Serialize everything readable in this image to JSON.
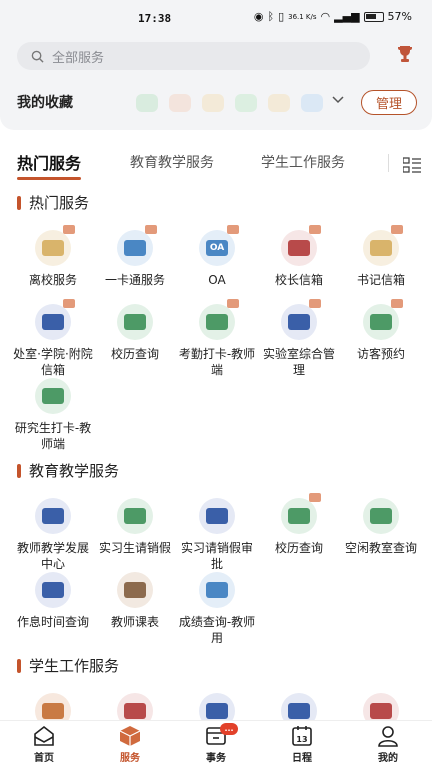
{
  "status": {
    "time": "17:38",
    "network": "36.1 K/s",
    "battery": "57%"
  },
  "search": {
    "placeholder": "全部服务"
  },
  "favorites": {
    "label": "我的收藏",
    "manage_label": "管理"
  },
  "tabs": [
    "热门服务",
    "教育教学服务",
    "学生工作服务"
  ],
  "sections": [
    {
      "title": "热门服务",
      "items": [
        {
          "label": "离校服务",
          "icon": "leave-school-icon",
          "bg": "c-sand",
          "glyph": "g-sand",
          "mark": true
        },
        {
          "label": "一卡通服务",
          "icon": "campus-card-icon",
          "bg": "c-blue",
          "glyph": "g-blue",
          "mark": true
        },
        {
          "label": "OA",
          "icon": "oa-icon",
          "bg": "c-blue",
          "glyph": "g-blue",
          "mark": true,
          "oa": "OA"
        },
        {
          "label": "校长信箱",
          "icon": "president-mailbox-icon",
          "bg": "c-red",
          "glyph": "g-red",
          "mark": true
        },
        {
          "label": "书记信箱",
          "icon": "secretary-mailbox-icon",
          "bg": "c-sand",
          "glyph": "g-sand",
          "mark": true
        },
        {
          "label": "处室·学院·附院信箱",
          "icon": "department-mailbox-icon",
          "bg": "c-navy",
          "glyph": "g-navy",
          "mark": true
        },
        {
          "label": "校历查询",
          "icon": "school-calendar-icon",
          "bg": "c-green",
          "glyph": "g-green",
          "mark": false
        },
        {
          "label": "考勤打卡-教师端",
          "icon": "attendance-icon",
          "bg": "c-green",
          "glyph": "g-green",
          "mark": true
        },
        {
          "label": "实验室综合管理",
          "icon": "lab-management-icon",
          "bg": "c-navy",
          "glyph": "g-navy",
          "mark": true
        },
        {
          "label": "访客预约",
          "icon": "visitor-icon",
          "bg": "c-green",
          "glyph": "g-green",
          "mark": true
        },
        {
          "label": "研究生打卡-教师端",
          "icon": "location-pin-icon",
          "bg": "c-green",
          "glyph": "g-green",
          "mark": false
        }
      ]
    },
    {
      "title": "教育教学服务",
      "items": [
        {
          "label": "教师教学发展中心",
          "icon": "teaching-center-icon",
          "bg": "c-navy",
          "glyph": "g-navy",
          "mark": false
        },
        {
          "label": "实习生请销假",
          "icon": "intern-leave-icon",
          "bg": "c-green",
          "glyph": "g-green",
          "mark": false
        },
        {
          "label": "实习请销假审批",
          "icon": "leave-approval-icon",
          "bg": "c-navy",
          "glyph": "g-navy",
          "mark": false
        },
        {
          "label": "校历查询",
          "icon": "school-calendar-icon",
          "bg": "c-green",
          "glyph": "g-green",
          "mark": true
        },
        {
          "label": "空闲教室查询",
          "icon": "free-classroom-icon",
          "bg": "c-green",
          "glyph": "g-green",
          "mark": false
        },
        {
          "label": "作息时间查询",
          "icon": "schedule-time-icon",
          "bg": "c-navy",
          "glyph": "g-navy",
          "mark": false
        },
        {
          "label": "教师课表",
          "icon": "teacher-timetable-icon",
          "bg": "c-brown",
          "glyph": "g-brown",
          "mark": false
        },
        {
          "label": "成绩查询-教师用",
          "icon": "grades-icon",
          "bg": "c-blue",
          "glyph": "g-blue",
          "mark": false
        }
      ]
    },
    {
      "title": "学生工作服务",
      "items": [
        {
          "label": "",
          "icon": "student-service-icon",
          "bg": "c-orange",
          "glyph": "g-orange",
          "mark": false
        },
        {
          "label": "",
          "icon": "graduate-icon",
          "bg": "c-red",
          "glyph": "g-red",
          "mark": false
        },
        {
          "label": "",
          "icon": "student-id-icon",
          "bg": "c-navy",
          "glyph": "g-navy",
          "mark": false
        },
        {
          "label": "",
          "icon": "student-card-icon",
          "bg": "c-navy",
          "glyph": "g-navy",
          "mark": false
        },
        {
          "label": "",
          "icon": "graduate-cap-icon",
          "bg": "c-red",
          "glyph": "g-red",
          "mark": false
        }
      ]
    }
  ],
  "nav": [
    {
      "label": "首页",
      "icon": "home-icon"
    },
    {
      "label": "服务",
      "icon": "service-box-icon"
    },
    {
      "label": "事务",
      "icon": "affairs-icon",
      "badge": "..."
    },
    {
      "label": "日程",
      "icon": "calendar-13-icon"
    },
    {
      "label": "我的",
      "icon": "user-icon"
    }
  ],
  "colors": {
    "accent": "#c4542c"
  }
}
